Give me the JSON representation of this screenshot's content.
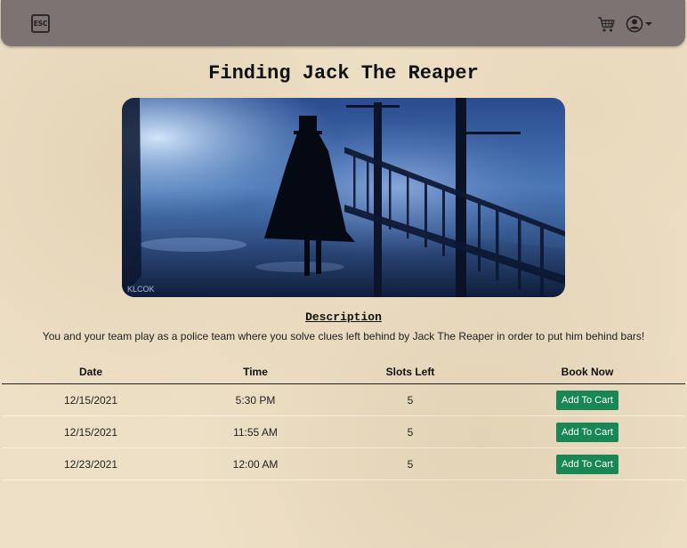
{
  "navbar": {
    "logo_text": "ESC",
    "cart_icon": "shopping-cart-icon",
    "user_icon": "user-circle-icon"
  },
  "escape_room": {
    "title": "Finding Jack The Reaper",
    "image_watermark": "KLCOK",
    "description_heading": "Description",
    "description": "You and your team play as a police team where you solve clues left behind by Jack The Reaper in order to put him behind bars!"
  },
  "schedule": {
    "headers": [
      "Date",
      "Time",
      "Slots Left",
      "Book Now"
    ],
    "rows": [
      {
        "date": "12/15/2021",
        "time": "5:30 PM",
        "slots": "5",
        "action": "Add To Cart"
      },
      {
        "date": "12/15/2021",
        "time": "11:55 AM",
        "slots": "5",
        "action": "Add To Cart"
      },
      {
        "date": "12/23/2021",
        "time": "12:00 AM",
        "slots": "5",
        "action": "Add To Cart"
      }
    ]
  },
  "colors": {
    "navbar": "#7d7373",
    "background": "#eee0c6",
    "button": "#198754"
  }
}
